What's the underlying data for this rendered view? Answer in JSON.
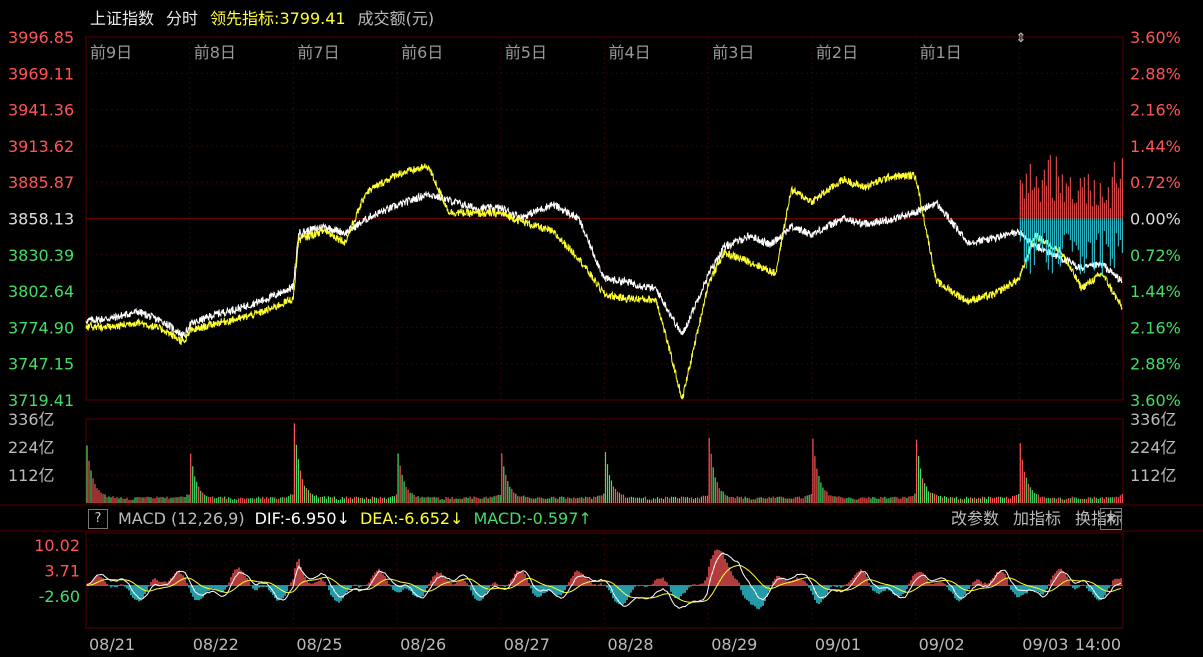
{
  "header": {
    "index_name": "上证指数",
    "period": "分时",
    "leading_label": "领先指标:",
    "leading_value": "3799.41",
    "volume_label": "成交额(元)"
  },
  "macd": {
    "help": "?",
    "title": "MACD (12,26,9)",
    "dif": "DIF:-6.950↓",
    "dea": "DEA:-6.652↓",
    "macd": "MACD:-0.597↑",
    "buttons": [
      "改参数",
      "加指标",
      "换指标"
    ],
    "close": "✕"
  },
  "colors": {
    "up": "#ff5555",
    "down": "#44dd66",
    "price_line": "#ffffff",
    "leading_line": "#ffff33",
    "macd_neg": "#33ddee",
    "macd_pos": "#ff5555",
    "grid": "#3a0000"
  },
  "chart_data": [
    {
      "type": "line",
      "name": "price",
      "y_labels_left": [
        "3996.85",
        "3969.11",
        "3941.36",
        "3913.62",
        "3885.87",
        "3858.13",
        "3830.39",
        "3802.64",
        "3774.90",
        "3747.15",
        "3719.41"
      ],
      "y_labels_right": [
        "3.60%",
        "2.88%",
        "2.16%",
        "1.44%",
        "0.72%",
        "0.00%",
        "0.72%",
        "1.44%",
        "2.16%",
        "2.88%",
        "3.60%"
      ],
      "ylim": [
        3719.41,
        3996.85
      ],
      "day_labels": [
        "前9日",
        "前8日",
        "前7日",
        "前6日",
        "前5日",
        "前4日",
        "前3日",
        "前2日",
        "前1日"
      ],
      "series": [
        {
          "name": "",
          "color": "#ffffff",
          "x": [
            0,
            0.25,
            0.5,
            0.75,
            0.95,
            1.0,
            1.25,
            1.5,
            1.75,
            2.0,
            2.05,
            2.3,
            2.5,
            2.75,
            3.0,
            3.3,
            3.5,
            3.75,
            4.0,
            4.2,
            4.5,
            4.75,
            5.0,
            5.2,
            5.5,
            5.75,
            6.0,
            6.15,
            6.4,
            6.6,
            6.8,
            7.0,
            7.3,
            7.5,
            7.75,
            8.0,
            8.2,
            8.5,
            8.75,
            9.0,
            9.15,
            9.4,
            9.6,
            9.8,
            9.99
          ],
          "values": [
            3780,
            3782,
            3787,
            3779,
            3768,
            3777,
            3785,
            3790,
            3797,
            3806,
            3847,
            3852,
            3847,
            3860,
            3868,
            3877,
            3872,
            3866,
            3866,
            3859,
            3869,
            3858,
            3812,
            3810,
            3804,
            3769,
            3815,
            3836,
            3845,
            3838,
            3852,
            3846,
            3858,
            3854,
            3857,
            3863,
            3870,
            3840,
            3843,
            3848,
            3837,
            3828,
            3820,
            3823,
            3810
          ]
        },
        {
          "name": "",
          "color": "#ffff33",
          "x": [
            0,
            0.25,
            0.5,
            0.75,
            0.95,
            1.0,
            1.25,
            1.5,
            1.75,
            2.0,
            2.05,
            2.3,
            2.5,
            2.7,
            3.0,
            3.3,
            3.5,
            3.75,
            4.0,
            4.2,
            4.5,
            4.75,
            5.0,
            5.2,
            5.5,
            5.75,
            6.0,
            6.15,
            6.4,
            6.65,
            6.8,
            7.0,
            7.3,
            7.5,
            7.75,
            8.0,
            8.2,
            8.5,
            8.75,
            9.0,
            9.15,
            9.4,
            9.6,
            9.8,
            9.99
          ],
          "values": [
            3776,
            3775,
            3779,
            3773,
            3763,
            3772,
            3778,
            3782,
            3788,
            3797,
            3842,
            3849,
            3840,
            3878,
            3892,
            3898,
            3863,
            3862,
            3862,
            3856,
            3848,
            3828,
            3800,
            3797,
            3796,
            3720,
            3808,
            3832,
            3825,
            3816,
            3880,
            3871,
            3888,
            3882,
            3890,
            3891,
            3810,
            3795,
            3800,
            3812,
            3845,
            3833,
            3805,
            3816,
            3790
          ]
        }
      ]
    },
    {
      "type": "bar",
      "name": "volume",
      "y_labels": [
        "336亿",
        "224亿",
        "112亿"
      ],
      "ylim": [
        0,
        336
      ],
      "session_open_values": [
        230,
        195,
        315,
        195,
        195,
        200,
        260,
        250,
        250,
        230
      ],
      "session_base_value": 16
    },
    {
      "type": "bar",
      "name": "macd",
      "y_labels": [
        "10.02",
        "3.71",
        "-2.60"
      ],
      "ylim": [
        -10.5,
        13.0
      ],
      "x_labels": [
        "08/21",
        "08/22",
        "08/25",
        "08/26",
        "08/27",
        "08/28",
        "08/29",
        "09/01",
        "09/02",
        "09/03",
        "14:00"
      ],
      "series_names": [
        "DIF",
        "DEA",
        "MACD"
      ]
    }
  ]
}
